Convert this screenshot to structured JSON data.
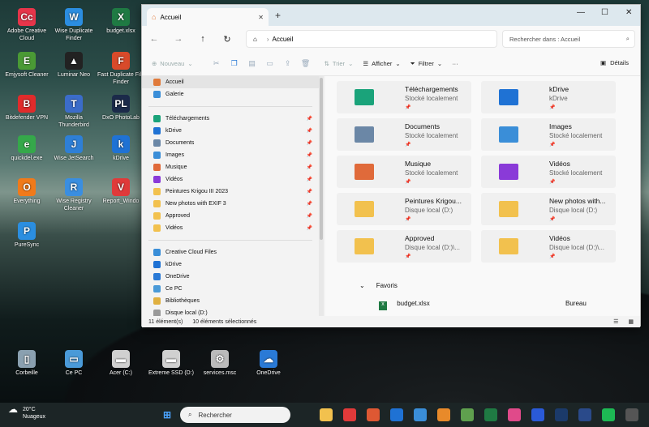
{
  "desktop": {
    "icons": [
      {
        "label": "Adobe Creative Cloud",
        "icon": "creative-cloud",
        "color": "#e6354a",
        "glyph": "Cc"
      },
      {
        "label": "Wise Duplicate Finder",
        "icon": "wise-duplicate",
        "color": "#2b8de0",
        "glyph": "W"
      },
      {
        "label": "budget.xlsx",
        "icon": "excel",
        "color": "#1f7a43",
        "glyph": "X"
      },
      {
        "label": "Emjysoft Cleaner",
        "icon": "emjysoft",
        "color": "#4a9a35",
        "glyph": "E"
      },
      {
        "label": "Luminar Neo",
        "icon": "luminar",
        "color": "#222",
        "glyph": "▲"
      },
      {
        "label": "Fast Duplicate File Finder",
        "icon": "fast-duplicate",
        "color": "#d94a2a",
        "glyph": "F"
      },
      {
        "label": "Bitdefender VPN",
        "icon": "bitdefender",
        "color": "#e02b2b",
        "glyph": "B"
      },
      {
        "label": "Mozilla Thunderbird",
        "icon": "thunderbird",
        "color": "#3b6cc9",
        "glyph": "T"
      },
      {
        "label": "DxO PhotoLab",
        "icon": "dxo",
        "color": "#1b2a4a",
        "glyph": "PL"
      },
      {
        "label": "quickdel.exe",
        "icon": "quickdel",
        "color": "#35a84a",
        "glyph": "e"
      },
      {
        "label": "Wise JetSearch",
        "icon": "jetsearch",
        "color": "#2e7fd6",
        "glyph": "J"
      },
      {
        "label": "kDrive",
        "icon": "kdrive",
        "color": "#1f72d4",
        "glyph": "k"
      },
      {
        "label": "Everything",
        "icon": "everything",
        "color": "#f07a1a",
        "glyph": "O"
      },
      {
        "label": "Wise Registry Cleaner",
        "icon": "registry",
        "color": "#3a8ee0",
        "glyph": "R"
      },
      {
        "label": "Report_Windo",
        "icon": "vivaldi",
        "color": "#e03a3a",
        "glyph": "V"
      },
      {
        "label": "PureSync",
        "icon": "puresync",
        "color": "#2b8ee0",
        "glyph": "P"
      },
      {
        "label": "Corbeille",
        "icon": "recycle-bin",
        "color": "#8aa0b0",
        "glyph": "▯"
      },
      {
        "label": "Ce PC",
        "icon": "computer",
        "color": "#4a9ad8",
        "glyph": "▭"
      },
      {
        "label": "Acer (C:)",
        "icon": "drive",
        "color": "#d0d0d0",
        "glyph": "▬"
      },
      {
        "label": "Extreme SSD (D:)",
        "icon": "drive",
        "color": "#d0d0d0",
        "glyph": "▬"
      },
      {
        "label": "services.msc",
        "icon": "gear",
        "color": "#bbb",
        "glyph": "⚙"
      },
      {
        "label": "OneDrive",
        "icon": "onedrive",
        "color": "#2a7ad6",
        "glyph": "☁"
      }
    ]
  },
  "window": {
    "tab_title": "Accueil",
    "close": "✕",
    "newtab": "+",
    "minimize": "—",
    "maximize": "☐",
    "closewin": "✕"
  },
  "nav": {
    "address": "Accueil",
    "search_placeholder": "Rechercher dans : Accueil"
  },
  "toolbar": {
    "new": "Nouveau",
    "sort": "Trier",
    "view": "Afficher",
    "filter": "Filtrer",
    "more": "···",
    "details": "Détails"
  },
  "sidebar": {
    "top": [
      {
        "label": "Accueil"
      },
      {
        "label": "Galerie"
      }
    ],
    "pinned": [
      {
        "label": "Téléchargements",
        "color": "#1aa37a"
      },
      {
        "label": "kDrive",
        "color": "#1f72d4"
      },
      {
        "label": "Documents",
        "color": "#6b87a6"
      },
      {
        "label": "Images",
        "color": "#3a8ed8"
      },
      {
        "label": "Musique",
        "color": "#e06a3a"
      },
      {
        "label": "Vidéos",
        "color": "#8a3ad8"
      },
      {
        "label": "Peintures Krigou III 2023",
        "color": "#f2c14e"
      },
      {
        "label": "New photos with EXIF 3",
        "color": "#f2c14e"
      },
      {
        "label": "Approved",
        "color": "#f2c14e"
      },
      {
        "label": "Vidéos",
        "color": "#f2c14e"
      }
    ],
    "drives": [
      {
        "label": "Creative Cloud Files",
        "color": "#3a8ed8"
      },
      {
        "label": "kDrive",
        "color": "#1f72d4"
      },
      {
        "label": "OneDrive",
        "color": "#2a7ad6"
      },
      {
        "label": "Ce PC",
        "color": "#4a9ad8"
      },
      {
        "label": "Bibliothèques",
        "color": "#e0b040"
      },
      {
        "label": "Disque local (D:)",
        "color": "#999"
      }
    ]
  },
  "cards": [
    {
      "name": "Téléchargements",
      "sub": "Stocké localement",
      "color": "#1aa37a"
    },
    {
      "name": "kDrive",
      "sub": "kDrive",
      "color": "#1f72d4"
    },
    {
      "name": "Documents",
      "sub": "Stocké localement",
      "color": "#6b87a6"
    },
    {
      "name": "Images",
      "sub": "Stocké localement",
      "color": "#3a8ed8"
    },
    {
      "name": "Musique",
      "sub": "Stocké localement",
      "color": "#e06a3a"
    },
    {
      "name": "Vidéos",
      "sub": "Stocké localement",
      "color": "#8a3ad8"
    },
    {
      "name": "Peintures Krigou...",
      "sub": "Disque local (D:)",
      "color": "#f2c14e"
    },
    {
      "name": "New photos with...",
      "sub": "Disque local (D:)",
      "color": "#f2c14e"
    },
    {
      "name": "Approved",
      "sub": "Disque local (D:)\\...",
      "color": "#f2c14e"
    },
    {
      "name": "Vidéos",
      "sub": "Disque local (D:)\\...",
      "color": "#f2c14e"
    }
  ],
  "favorites": {
    "header": "Favoris",
    "file": "budget.xlsx",
    "location": "Bureau"
  },
  "status": {
    "count": "11 élément(s)",
    "selected": "10 éléments sélectionnés"
  },
  "taskbar": {
    "temp": "20°C",
    "weather": "Nuageux",
    "search": "Rechercher",
    "apps": [
      "explorer",
      "vivaldi",
      "duckduckgo",
      "kdrive",
      "store",
      "vlc",
      "paint",
      "excel",
      "photos",
      "ps",
      "ps2",
      "lrc",
      "spotify",
      "chatgpt",
      "opera"
    ]
  }
}
